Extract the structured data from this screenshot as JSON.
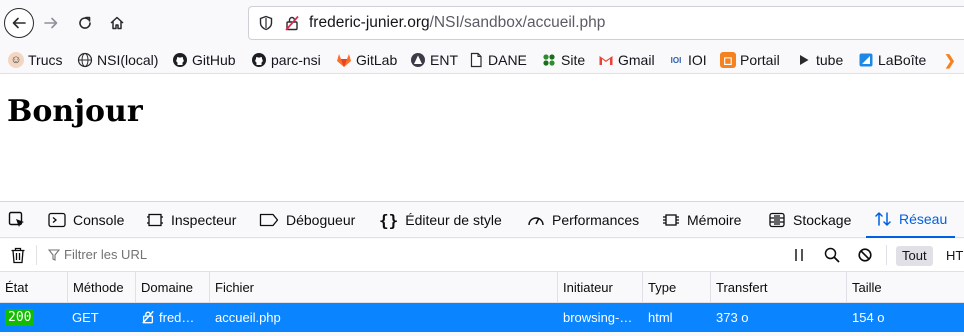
{
  "browser": {
    "url_domain": "frederic-junier.org",
    "url_path": "/NSI/sandbox/accueil.php"
  },
  "bookmarks": [
    {
      "label": "Trucs",
      "icon": "avatar-icon"
    },
    {
      "label": "NSI(local)",
      "icon": "globe-icon"
    },
    {
      "label": "GitHub",
      "icon": "github-icon"
    },
    {
      "label": "parc-nsi",
      "icon": "github-icon"
    },
    {
      "label": "GitLab",
      "icon": "gitlab-icon"
    },
    {
      "label": "ENT",
      "icon": "ent-icon"
    },
    {
      "label": "DANE",
      "icon": "document-icon"
    },
    {
      "label": "Site",
      "icon": "site-icon"
    },
    {
      "label": "Gmail",
      "icon": "gmail-icon"
    },
    {
      "label": "IOI",
      "icon": "ioi-icon"
    },
    {
      "label": "Portail",
      "icon": "portail-icon"
    },
    {
      "label": "tube",
      "icon": "play-icon"
    },
    {
      "label": "LaBoîte",
      "icon": "laboite-icon"
    }
  ],
  "page": {
    "heading": "Bonjour"
  },
  "devtools": {
    "tabs": [
      {
        "label": "Console",
        "icon": "console-icon"
      },
      {
        "label": "Inspecteur",
        "icon": "inspector-icon"
      },
      {
        "label": "Débogueur",
        "icon": "debugger-icon"
      },
      {
        "label": "Éditeur de style",
        "icon": "style-editor-icon"
      },
      {
        "label": "Performances",
        "icon": "performance-icon"
      },
      {
        "label": "Mémoire",
        "icon": "memory-icon"
      },
      {
        "label": "Stockage",
        "icon": "storage-icon"
      },
      {
        "label": "Réseau",
        "icon": "network-icon",
        "active": true
      }
    ],
    "filter_placeholder": "Filtrer les URL",
    "filter_all": "Tout",
    "filter_html": "HT",
    "columns": [
      "État",
      "Méthode",
      "Domaine",
      "Fichier",
      "Initiateur",
      "Type",
      "Transfert",
      "Taille"
    ],
    "requests": [
      {
        "status": "200",
        "method": "GET",
        "domain": "fred…",
        "file": "accueil.php",
        "initiator": "browsing-…",
        "type": "html",
        "transferred": "373 o",
        "size": "154 o"
      }
    ]
  },
  "colors": {
    "accent": "#0060df",
    "selected_row": "#0a84ff",
    "status_ok": "#12bc00"
  }
}
